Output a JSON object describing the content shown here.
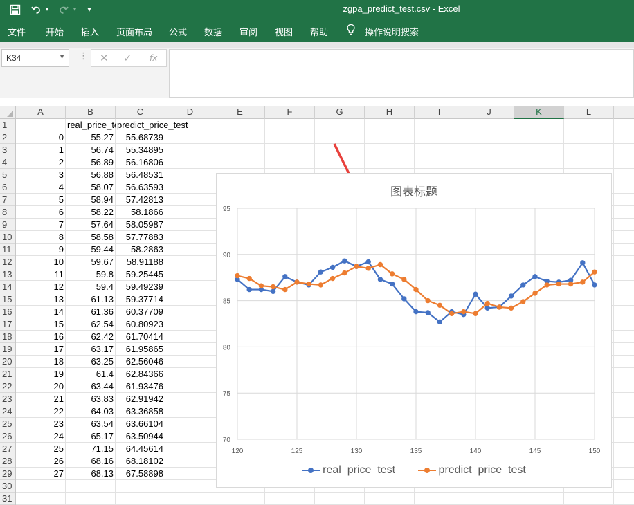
{
  "window": {
    "title": "zgpa_predict_test.csv  -  Excel"
  },
  "ribbon": {
    "tabs": [
      "文件",
      "开始",
      "插入",
      "页面布局",
      "公式",
      "数据",
      "审阅",
      "视图",
      "帮助"
    ],
    "tellme": "操作说明搜索"
  },
  "formula_bar": {
    "name_box": "K34",
    "cancel": "✕",
    "confirm": "✓",
    "fx": "fx",
    "content": ""
  },
  "grid": {
    "columns": [
      "A",
      "B",
      "C",
      "D",
      "E",
      "F",
      "G",
      "H",
      "I",
      "J",
      "K",
      "L"
    ],
    "selected_column": "K",
    "row_numbers": [
      1,
      2,
      3,
      4,
      5,
      6,
      7,
      8,
      9,
      10,
      11,
      12,
      13,
      14,
      15,
      16,
      17,
      18,
      19,
      20,
      21,
      22,
      23,
      24,
      25,
      26,
      27,
      28,
      29,
      30,
      31
    ],
    "headers": [
      "",
      "real_price_test",
      "predict_price_test"
    ],
    "rows": [
      [
        "0",
        "55.27",
        "55.68739"
      ],
      [
        "1",
        "56.74",
        "55.34895"
      ],
      [
        "2",
        "56.89",
        "56.16806"
      ],
      [
        "3",
        "56.88",
        "56.48531"
      ],
      [
        "4",
        "58.07",
        "56.63593"
      ],
      [
        "5",
        "58.94",
        "57.42813"
      ],
      [
        "6",
        "58.22",
        "58.1866"
      ],
      [
        "7",
        "57.64",
        "58.05987"
      ],
      [
        "8",
        "58.58",
        "57.77883"
      ],
      [
        "9",
        "59.44",
        "58.2863"
      ],
      [
        "10",
        "59.67",
        "58.91188"
      ],
      [
        "11",
        "59.8",
        "59.25445"
      ],
      [
        "12",
        "59.4",
        "59.49239"
      ],
      [
        "13",
        "61.13",
        "59.37714"
      ],
      [
        "14",
        "61.36",
        "60.37709"
      ],
      [
        "15",
        "62.54",
        "60.80923"
      ],
      [
        "16",
        "62.42",
        "61.70414"
      ],
      [
        "17",
        "63.17",
        "61.95865"
      ],
      [
        "18",
        "63.25",
        "62.56046"
      ],
      [
        "19",
        "61.4",
        "62.84366"
      ],
      [
        "20",
        "63.44",
        "61.93476"
      ],
      [
        "21",
        "63.83",
        "62.91942"
      ],
      [
        "22",
        "64.03",
        "63.36858"
      ],
      [
        "23",
        "63.54",
        "63.66104"
      ],
      [
        "24",
        "65.17",
        "63.50944"
      ],
      [
        "25",
        "71.15",
        "64.45614"
      ],
      [
        "26",
        "68.16",
        "68.18102"
      ],
      [
        "27",
        "68.13",
        "67.58898"
      ]
    ]
  },
  "chart_data": {
    "type": "line",
    "title": "图表标题",
    "xlabel": "",
    "ylabel": "",
    "xlim": [
      120,
      150
    ],
    "ylim": [
      70,
      95
    ],
    "x_ticks": [
      120,
      125,
      130,
      135,
      140,
      145,
      150
    ],
    "y_ticks": [
      70,
      75,
      80,
      85,
      90,
      95
    ],
    "grid": true,
    "legend": "bottom",
    "x": [
      120,
      121,
      122,
      123,
      124,
      125,
      126,
      127,
      128,
      129,
      130,
      131,
      132,
      133,
      134,
      135,
      136,
      137,
      138,
      139,
      140,
      141,
      142,
      143,
      144,
      145,
      146,
      147,
      148,
      149,
      150
    ],
    "series": [
      {
        "name": "real_price_test",
        "color": "#4472c4",
        "values": [
          87.3,
          86.2,
          86.2,
          86.0,
          87.6,
          87.0,
          86.7,
          88.1,
          88.6,
          89.3,
          88.7,
          89.2,
          87.3,
          86.8,
          85.2,
          83.8,
          83.7,
          82.7,
          83.8,
          83.5,
          85.7,
          84.2,
          84.3,
          85.5,
          86.7,
          87.6,
          87.1,
          87.0,
          87.2,
          89.1,
          86.7
        ]
      },
      {
        "name": "predict_price_test",
        "color": "#ed7d31",
        "values": [
          87.7,
          87.4,
          86.6,
          86.5,
          86.2,
          87.0,
          86.8,
          86.7,
          87.4,
          88.0,
          88.7,
          88.5,
          88.9,
          87.9,
          87.3,
          86.2,
          85.0,
          84.5,
          83.6,
          83.8,
          83.6,
          84.7,
          84.3,
          84.2,
          84.9,
          85.8,
          86.7,
          86.8,
          86.8,
          87.0,
          88.1
        ]
      }
    ]
  },
  "annotation": {
    "type": "arrow",
    "color": "#e8413c"
  }
}
